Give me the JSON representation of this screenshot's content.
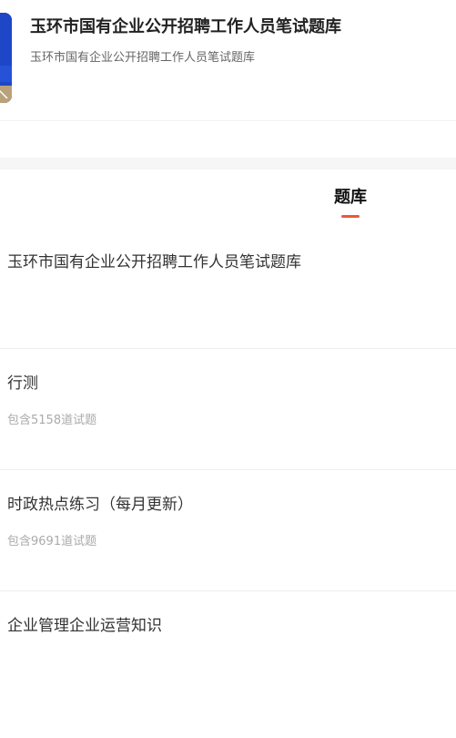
{
  "header": {
    "title": "玉环市国有企业公开招聘工作人员笔试题库",
    "subtitle": "玉环市国有企业公开招聘工作人员笔试题库"
  },
  "tabs": [
    {
      "label": "题库",
      "active": true
    }
  ],
  "items": [
    {
      "title": "玉环市国有企业公开招聘工作人员笔试题库"
    },
    {
      "title": "行测",
      "count": "包含5158道试题"
    },
    {
      "title": "时政热点练习（每月更新）",
      "count": "包含9691道试题"
    },
    {
      "title": "企业管理企业运营知识"
    }
  ],
  "colors": {
    "accent": "#e8583a",
    "cover_blue": "#1e47c8",
    "cover_gold": "#b9a27a"
  },
  "icons": {
    "cover": "question-bank-cover-image"
  }
}
